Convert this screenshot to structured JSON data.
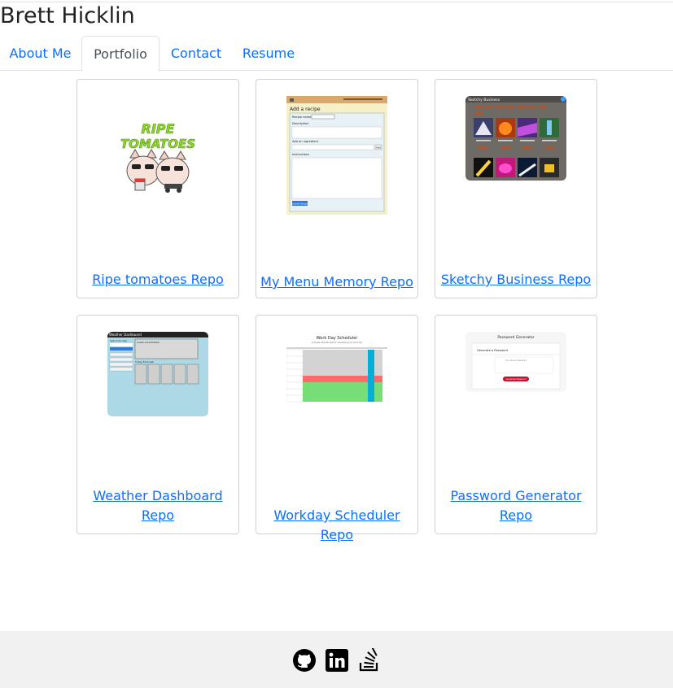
{
  "site": {
    "title": "Brett Hicklin"
  },
  "nav": {
    "tabs": [
      {
        "label": "About Me",
        "active": false
      },
      {
        "label": "Portfolio",
        "active": true
      },
      {
        "label": "Contact",
        "active": false
      },
      {
        "label": "Resume",
        "active": false
      }
    ]
  },
  "portfolio": {
    "cards": [
      {
        "link": "Ripe tomatoes Repo",
        "thumb_text": [
          "RIPE",
          "TOMATOES"
        ]
      },
      {
        "link": "My Menu Memory Repo",
        "thumb_text": [
          "Add a recipe",
          "Recipe name:",
          "Description",
          "Add an ingredient",
          "Add",
          "Instructions",
          "Submit Recipe"
        ]
      },
      {
        "link": "Sketchy Business Repo",
        "thumb_text": [
          "Sketchy Business"
        ]
      },
      {
        "link": "Weather Dashboard Repo",
        "thumb_text": [
          "Weather Dashboard",
          "Search for City:",
          "Austin 01/23/2022",
          "5 Day Forecast:"
        ]
      },
      {
        "link": "Workday Scheduler Repo",
        "thumb_text": [
          "Work Day Scheduler",
          "A simple calendar app for scheduling your work day"
        ]
      },
      {
        "link": "Password Generator Repo",
        "thumb_text": [
          "Password Generator",
          "Generate a Password",
          "Your Secure Password",
          "Generate Password"
        ]
      }
    ]
  },
  "footer": {
    "icons": [
      "github-icon",
      "linkedin-icon",
      "stackoverflow-icon"
    ]
  },
  "colors": {
    "link": "#0d6efd",
    "footer_bg": "#f1f1f1",
    "weather_bg": "#add8e6",
    "scheduler_present": "#ff6b6b",
    "scheduler_future": "#77dd77"
  }
}
